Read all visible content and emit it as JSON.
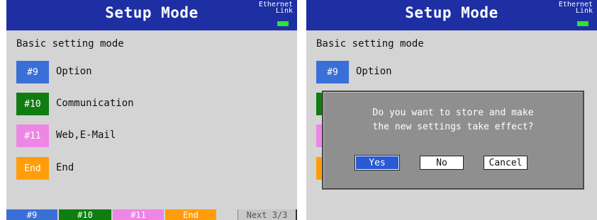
{
  "header": {
    "title": "Setup Mode",
    "ethernet_line1": "Ethernet",
    "ethernet_line2": "Link"
  },
  "mode_label": "Basic setting mode",
  "menu_items": [
    {
      "tag": "#9",
      "label": "Option",
      "color": "#3a6fd8"
    },
    {
      "tag": "#10",
      "label": "Communication",
      "color": "#0f7d0f"
    },
    {
      "tag": "#11",
      "label": "Web,E-Mail",
      "color": "#ee86e6"
    },
    {
      "tag": "End",
      "label": "End",
      "color": "#ff9e0a"
    }
  ],
  "softkeys": [
    {
      "label": "#9",
      "color": "#3a6fd8"
    },
    {
      "label": "#10",
      "color": "#0f7d0f"
    },
    {
      "label": "#11",
      "color": "#ee86e6"
    },
    {
      "label": "End",
      "color": "#ff9e0a"
    },
    {
      "label": "Next 3/3",
      "color": "#c8c8c8"
    }
  ],
  "dialog": {
    "line1": "Do you want to store and make",
    "line2": "the new settings take effect?",
    "yes_label": "Yes",
    "no_label": "No",
    "cancel_label": "Cancel"
  },
  "colors": {
    "titlebar": "#1d2fa3",
    "background": "#d4d4d4",
    "link_led": "#2ee32e",
    "dialog_bg": "#8f8f8f",
    "selected_button": "#2a5ad1"
  }
}
